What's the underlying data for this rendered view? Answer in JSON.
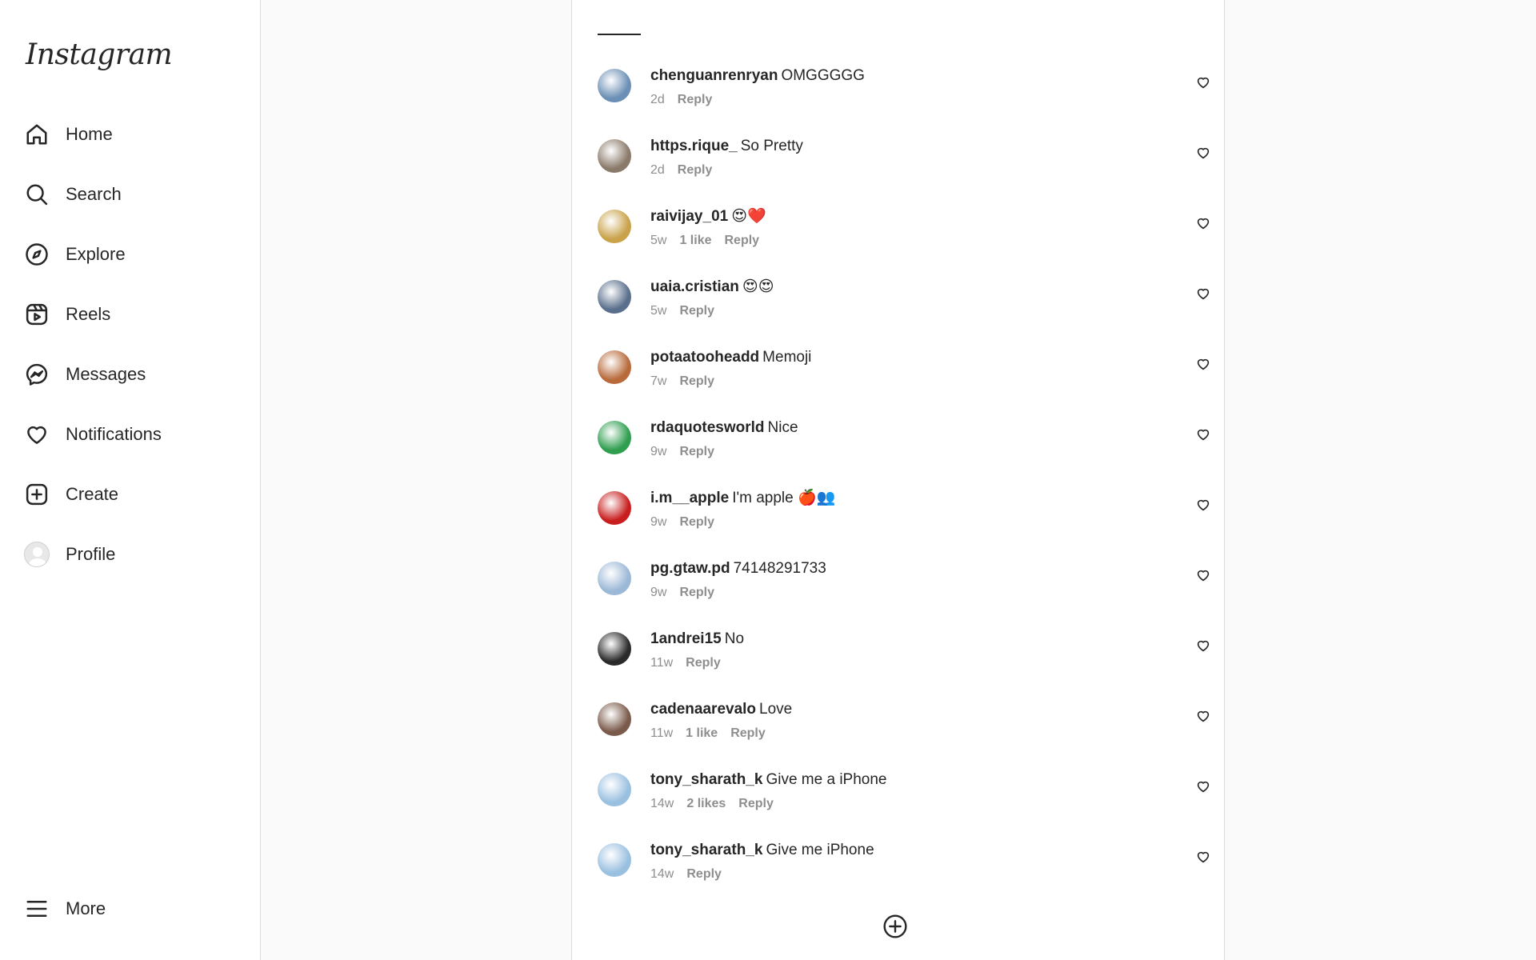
{
  "app": {
    "logo_text": "Instagram"
  },
  "sidebar": {
    "items": [
      {
        "label": "Home",
        "icon": "home-icon"
      },
      {
        "label": "Search",
        "icon": "search-icon"
      },
      {
        "label": "Explore",
        "icon": "compass-icon"
      },
      {
        "label": "Reels",
        "icon": "reels-icon"
      },
      {
        "label": "Messages",
        "icon": "messenger-icon"
      },
      {
        "label": "Notifications",
        "icon": "heart-icon"
      },
      {
        "label": "Create",
        "icon": "plus-square-icon"
      },
      {
        "label": "Profile",
        "icon": "avatar"
      }
    ],
    "more_label": "More"
  },
  "comments": [
    {
      "user": "chenguanrenryan",
      "text": "OMGGGGG",
      "age": "2d",
      "likes": "",
      "reply": "Reply",
      "avatar_color": "#6b8fb5"
    },
    {
      "user": "https.rique_",
      "text": "So Pretty",
      "age": "2d",
      "likes": "",
      "reply": "Reply",
      "avatar_color": "#8a7a6a"
    },
    {
      "user": "raivijay_01",
      "text": "😍❤️",
      "age": "5w",
      "likes": "1 like",
      "reply": "Reply",
      "avatar_color": "#c9a24a"
    },
    {
      "user": "uaia.cristian",
      "text": "😍😍",
      "age": "5w",
      "likes": "",
      "reply": "Reply",
      "avatar_color": "#5a6f8c"
    },
    {
      "user": "potaatooheadd",
      "text": "Memoji",
      "age": "7w",
      "likes": "",
      "reply": "Reply",
      "avatar_color": "#b86a3a"
    },
    {
      "user": "rdaquotesworld",
      "text": "Nice",
      "age": "9w",
      "likes": "",
      "reply": "Reply",
      "avatar_color": "#2f9e4f"
    },
    {
      "user": "i.m__apple",
      "text": "I'm apple 🍎👥",
      "age": "9w",
      "likes": "",
      "reply": "Reply",
      "avatar_color": "#c81e1e"
    },
    {
      "user": "pg.gtaw.pd",
      "text": "74148291733",
      "age": "9w",
      "likes": "",
      "reply": "Reply",
      "avatar_color": "#9bb8d6"
    },
    {
      "user": "1andrei15",
      "text": "No",
      "age": "11w",
      "likes": "",
      "reply": "Reply",
      "avatar_color": "#2a2a2a"
    },
    {
      "user": "cadenaarevalo",
      "text": "Love",
      "age": "11w",
      "likes": "1 like",
      "reply": "Reply",
      "avatar_color": "#7a5a4a"
    },
    {
      "user": "tony_sharath_k",
      "text": "Give me a iPhone",
      "age": "14w",
      "likes": "2 likes",
      "reply": "Reply",
      "avatar_color": "#9ac0e0"
    },
    {
      "user": "tony_sharath_k",
      "text": "Give me iPhone",
      "age": "14w",
      "likes": "",
      "reply": "Reply",
      "avatar_color": "#9ac0e0"
    }
  ],
  "colors": {
    "text": "#262626",
    "muted": "#8e8e8e",
    "border": "#dbdbdb",
    "background": "#fafafa"
  }
}
